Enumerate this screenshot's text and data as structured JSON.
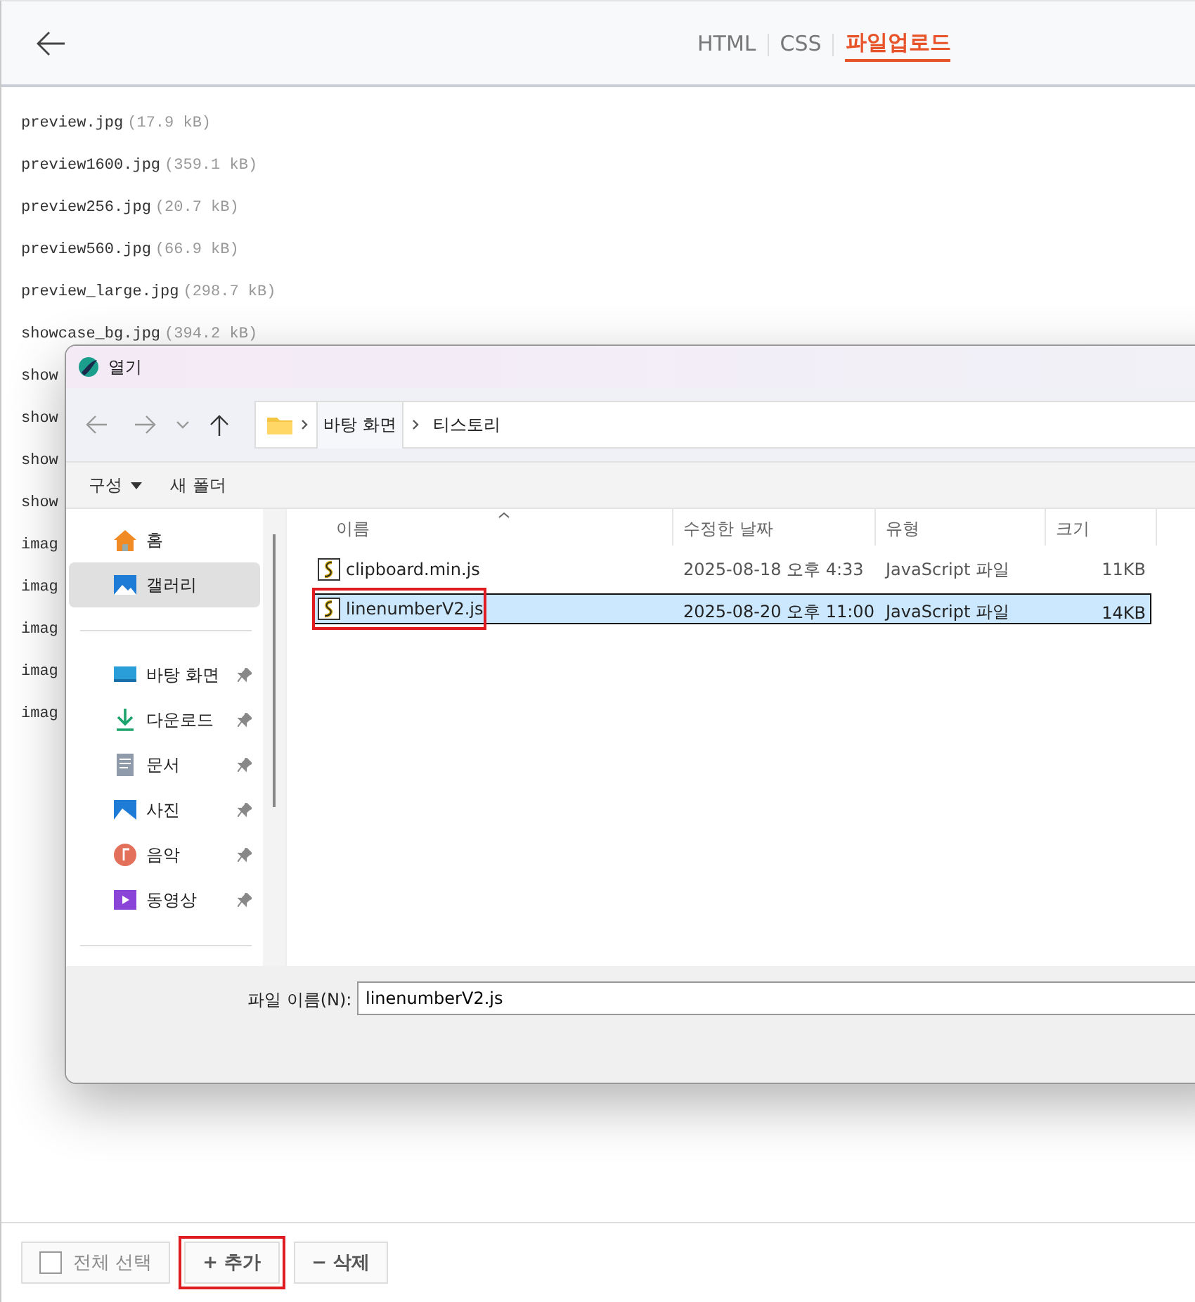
{
  "tabs": [
    {
      "label": "HTML",
      "selected": false
    },
    {
      "label": "CSS",
      "selected": false
    },
    {
      "label": "파일업로드",
      "selected": true
    }
  ],
  "files": [
    {
      "name": "preview.jpg",
      "size": "(17.9 kB)"
    },
    {
      "name": "preview1600.jpg",
      "size": "(359.1 kB)"
    },
    {
      "name": "preview256.jpg",
      "size": "(20.7 kB)"
    },
    {
      "name": "preview560.jpg",
      "size": "(66.9 kB)"
    },
    {
      "name": "preview_large.jpg",
      "size": "(298.7 kB)"
    },
    {
      "name": "showcase_bg.jpg",
      "size": "(394.2 kB)"
    },
    {
      "name": "show"
    },
    {
      "name": "show"
    },
    {
      "name": "show"
    },
    {
      "name": "show"
    },
    {
      "name": "imag"
    },
    {
      "name": "imag"
    },
    {
      "name": "imag"
    },
    {
      "name": "imag"
    },
    {
      "name": "imag"
    }
  ],
  "footer_buttons": [
    {
      "kind": "checkbox",
      "label": "전체 선택",
      "checked": false,
      "highlighted": false
    },
    {
      "kind": "add",
      "label": "+ 추가",
      "highlighted": true
    },
    {
      "kind": "remove",
      "label": "− 삭제",
      "highlighted": false
    }
  ],
  "dialog": {
    "title": "열기",
    "breadcrumb": [
      "바탕 화면",
      "티스토리"
    ],
    "toolbar": [
      {
        "label": "구성",
        "dropdown": true
      },
      {
        "label": "새 폴더",
        "dropdown": false
      }
    ],
    "sidebar": [
      {
        "kind": "home",
        "label": "홈",
        "selected": false,
        "pinned": false
      },
      {
        "kind": "gallery",
        "label": "갤러리",
        "selected": true,
        "pinned": false
      },
      {
        "kind": "divider"
      },
      {
        "kind": "desktop",
        "label": "바탕 화면",
        "selected": false,
        "pinned": true
      },
      {
        "kind": "download",
        "label": "다운로드",
        "selected": false,
        "pinned": true
      },
      {
        "kind": "document",
        "label": "문서",
        "selected": false,
        "pinned": true
      },
      {
        "kind": "photo",
        "label": "사진",
        "selected": false,
        "pinned": true
      },
      {
        "kind": "music",
        "label": "음악",
        "selected": false,
        "pinned": true
      },
      {
        "kind": "video",
        "label": "동영상",
        "selected": false,
        "pinned": true
      },
      {
        "kind": "divider"
      }
    ],
    "columns": [
      "이름",
      "수정한 날짜",
      "유형",
      "크기"
    ],
    "rows": [
      {
        "name": "clipboard.min.js",
        "modified": "2025-08-18 오후 4:33",
        "type": "JavaScript 파일",
        "size": "11KB",
        "selected": false,
        "highlighted": false
      },
      {
        "name": "linenumberV2.js",
        "modified": "2025-08-20 오후 11:00",
        "type": "JavaScript 파일",
        "size": "14KB",
        "selected": true,
        "highlighted": true
      }
    ],
    "filename_label": "파일 이름(N):",
    "filename_value": "linenumberV2.js"
  }
}
